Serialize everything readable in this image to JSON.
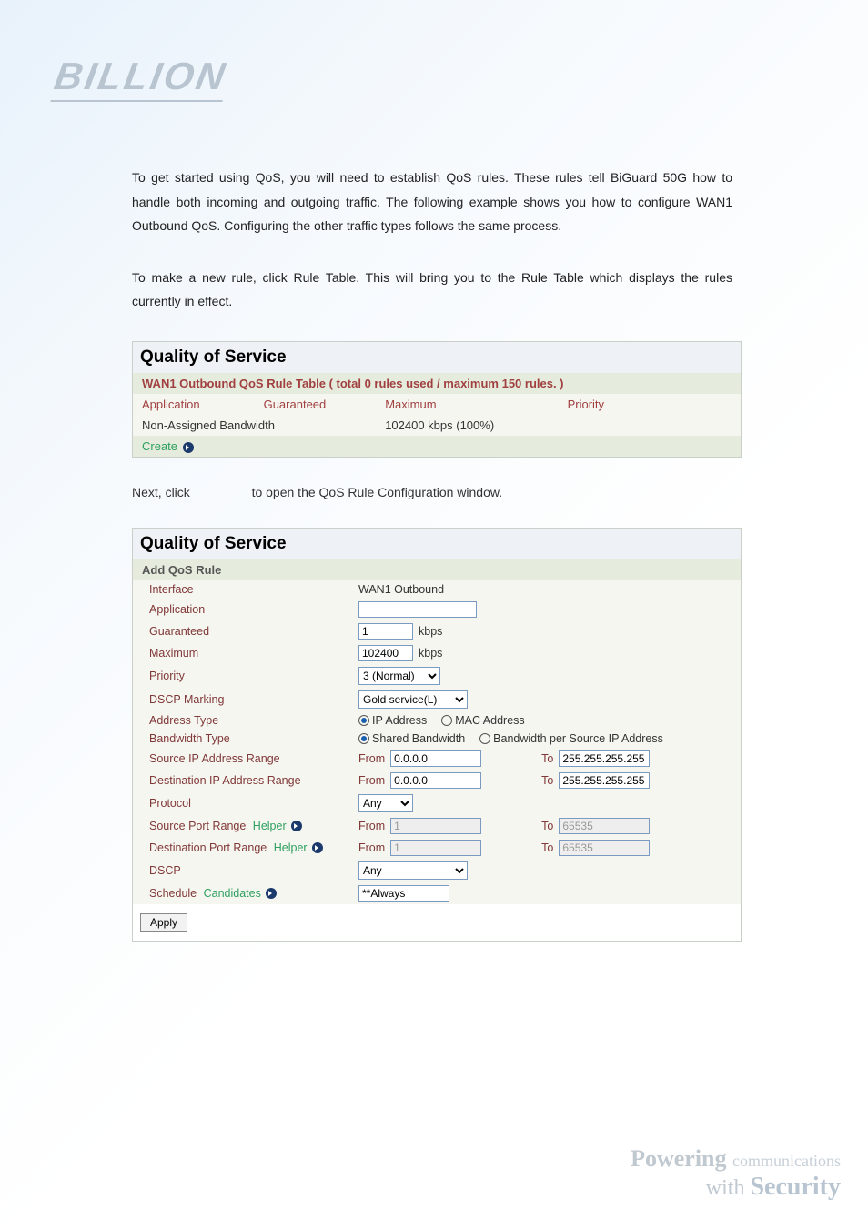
{
  "logo_text": "BILLION",
  "para1": "To get started using QoS, you will need to establish QoS rules. These rules tell BiGuard 50G how to handle both incoming and outgoing traffic. The following example shows you how to configure WAN1 Outbound QoS. Configuring the other traffic types follows the same process.",
  "para2": "To make a new rule, click Rule Table. This will bring you to the Rule Table which displays the rules currently in effect.",
  "after_prefix": "Next, click",
  "after_suffix": "to open the QoS Rule Configuration window.",
  "rule_table": {
    "title": "Quality of Service",
    "subtitle": "WAN1 Outbound QoS Rule Table ( total 0 rules used / maximum 150 rules. )",
    "headers": {
      "c1": "Application",
      "c2": "Guaranteed",
      "c3": "Maximum",
      "c4": "Priority"
    },
    "row1": {
      "c1": "Non-Assigned Bandwidth",
      "c3": "102400 kbps (100%)"
    },
    "create_label": "Create"
  },
  "add_rule": {
    "title": "Quality of Service",
    "subtitle": "Add QoS Rule",
    "rows": {
      "interface": {
        "label": "Interface",
        "value": "WAN1 Outbound"
      },
      "application": {
        "label": "Application",
        "value": ""
      },
      "guaranteed": {
        "label": "Guaranteed",
        "value": "1",
        "unit": "kbps"
      },
      "maximum": {
        "label": "Maximum",
        "value": "102400",
        "unit": "kbps"
      },
      "priority": {
        "label": "Priority",
        "value": "3 (Normal)"
      },
      "dscp_marking": {
        "label": "DSCP Marking",
        "value": "Gold service(L)"
      },
      "address_type": {
        "label": "Address Type",
        "opt1": "IP Address",
        "opt2": "MAC Address"
      },
      "bandwidth_type": {
        "label": "Bandwidth Type",
        "opt1": "Shared Bandwidth",
        "opt2": "Bandwidth per Source IP Address"
      },
      "src_ip_range": {
        "label": "Source IP Address Range",
        "from_label": "From",
        "from": "0.0.0.0",
        "to_label": "To",
        "to": "255.255.255.255"
      },
      "dst_ip_range": {
        "label": "Destination IP Address Range",
        "from_label": "From",
        "from": "0.0.0.0",
        "to_label": "To",
        "to": "255.255.255.255"
      },
      "protocol": {
        "label": "Protocol",
        "value": "Any"
      },
      "src_port_range": {
        "label": "Source Port Range",
        "helper": "Helper",
        "from_label": "From",
        "from": "1",
        "to_label": "To",
        "to": "65535"
      },
      "dst_port_range": {
        "label": "Destination Port Range",
        "helper": "Helper",
        "from_label": "From",
        "from": "1",
        "to_label": "To",
        "to": "65535"
      },
      "dscp": {
        "label": "DSCP",
        "value": "Any"
      },
      "schedule": {
        "label": "Schedule",
        "candidates": "Candidates",
        "value": "**Always"
      }
    },
    "apply_label": "Apply"
  },
  "footer": {
    "line1a": "Powering",
    "line1b": "communications",
    "line2a": "with",
    "line2b": "Security"
  }
}
